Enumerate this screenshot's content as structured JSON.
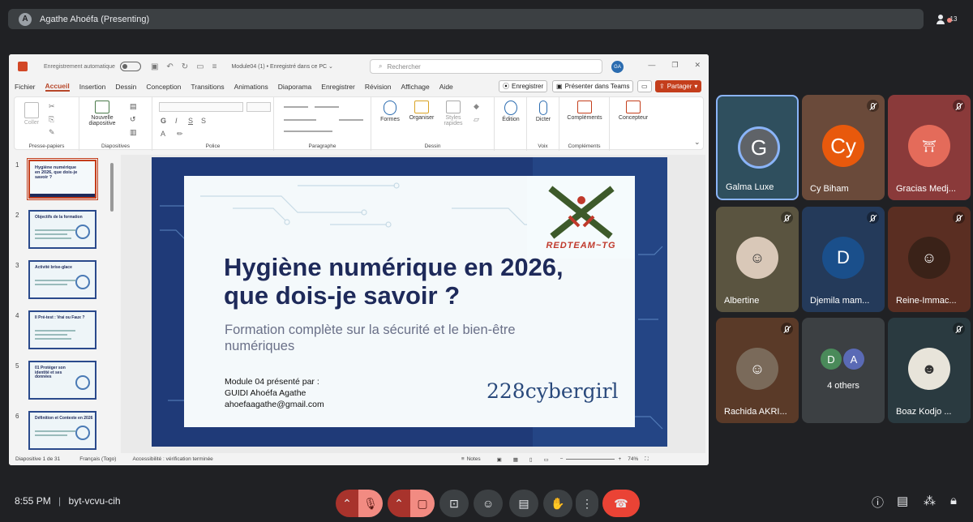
{
  "top_bar": {
    "presenter_initial": "A",
    "presenter_title": "Agathe Ahoéfa (Presenting)",
    "participant_count": "13"
  },
  "ppt": {
    "autosave_label": "Enregistrement automatique",
    "file_name": "Module04 (1) • Enregistré dans ce PC ⌄",
    "search_placeholder": "Rechercher",
    "user_initials": "GA",
    "menu": [
      "Fichier",
      "Accueil",
      "Insertion",
      "Dessin",
      "Conception",
      "Transitions",
      "Animations",
      "Diaporama",
      "Enregistrer",
      "Révision",
      "Affichage",
      "Aide"
    ],
    "record_label": "Enregistrer",
    "present_teams_label": "Présenter dans Teams",
    "share_label": "Partager",
    "ribbon": {
      "coller": "Coller",
      "nouvelle_diapositive": "Nouvelle diapositive",
      "formes": "Formes",
      "organiser": "Organiser",
      "styles_rapides": "Styles rapides",
      "edition": "Édition",
      "dicter": "Dicter",
      "complements": "Compléments",
      "concepteur": "Concepteur",
      "groups": [
        "Presse-papiers",
        "Diapositives",
        "Police",
        "Paragraphe",
        "Dessin",
        "Voix",
        "Compléments"
      ]
    },
    "thumbnails": [
      {
        "num": "1",
        "title": "Hygiène numérique en 2026, que dois-je savoir ?"
      },
      {
        "num": "2",
        "title": "Objectifs de la formation"
      },
      {
        "num": "3",
        "title": "Activité brise-glace"
      },
      {
        "num": "4",
        "title": "Il Pré-test : Vrai ou Faux ?"
      },
      {
        "num": "5",
        "title": "01 Protéger son identité et ses données"
      },
      {
        "num": "6",
        "title": "Définition et Contexte en 2026"
      }
    ],
    "slide": {
      "title": "Hygiène numérique en 2026, que dois-je savoir ?",
      "subtitle": "Formation complète sur la sécurité et le bien-être numériques",
      "author_line1": "Module 04 présenté par :",
      "author_line2": "GUIDI Ahoéfa Agathe",
      "author_line3": "ahoefaagathe@gmail.com",
      "brand": "228cybergirl",
      "logo_text": "REDTEAM~TG"
    },
    "status": {
      "slide_count": "Diapositive 1 de 31",
      "language": "Français (Togo)",
      "accessibility": "Accessibilité : vérification terminée",
      "notes": "Notes",
      "zoom": "74%"
    }
  },
  "participants": [
    {
      "name": "Galma Luxe",
      "initial": "G",
      "color": "#5f6368",
      "muted": false,
      "kind": "letter"
    },
    {
      "name": "Cy Biham",
      "initial": "Cy",
      "color": "#e8590c",
      "muted": true,
      "kind": "letter"
    },
    {
      "name": "Gracias Medj...",
      "initial": "",
      "color": "#e46b5a",
      "muted": true,
      "kind": "photo"
    },
    {
      "name": "Albertine",
      "initial": "",
      "color": "#d9c8b8",
      "muted": true,
      "kind": "photo"
    },
    {
      "name": "Djemila mam...",
      "initial": "D",
      "color": "#1a4f8b",
      "muted": true,
      "kind": "letter"
    },
    {
      "name": "Reine-Immac...",
      "initial": "",
      "color": "#5a3a2a",
      "muted": true,
      "kind": "photo"
    },
    {
      "name": "Rachida AKRI...",
      "initial": "",
      "color": "#7a6a5a",
      "muted": true,
      "kind": "photo"
    },
    {
      "name": "4 others",
      "initial": "",
      "color": "#3c4043",
      "muted": false,
      "kind": "others"
    },
    {
      "name": "Boaz Kodjo ...",
      "initial": "",
      "color": "#e8e4da",
      "muted": true,
      "kind": "photo"
    }
  ],
  "others_avatars": [
    "D",
    "A"
  ],
  "bottom": {
    "time": "8:55 PM",
    "separator": "|",
    "meeting_code": "byt-vcvu-cih"
  }
}
